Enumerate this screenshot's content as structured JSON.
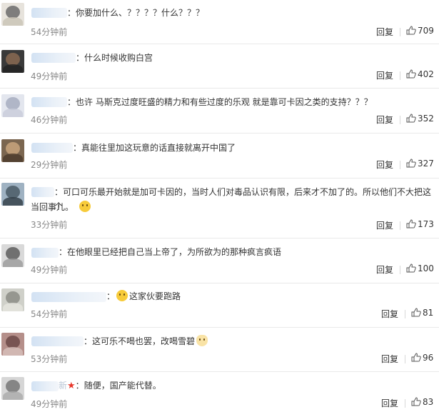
{
  "comments": [
    {
      "text": "你要加什么、？？？？什么？？？",
      "time": "54分钟前",
      "reply": "回复",
      "likes": "709",
      "emoji": ""
    },
    {
      "text": "什么时候收购白宫",
      "time": "49分钟前",
      "reply": "回复",
      "likes": "402",
      "emoji": ""
    },
    {
      "text": "也许 马斯克过度旺盛的精力和有些过度的乐观 就是靠可卡因之类的支持？？？",
      "time": "46分钟前",
      "reply": "回复",
      "likes": "352",
      "emoji": ""
    },
    {
      "text": "真能往里加这玩意的话直接就离开中国了",
      "time": "29分钟前",
      "reply": "回复",
      "likes": "327",
      "emoji": ""
    },
    {
      "text": "可口可乐最开始就是加可卡因的，当时人们对毒品认识有限，后来才不加了的。所以他们不大把这个",
      "text2": "当回事儿。",
      "time": "33分钟前",
      "reply": "回复",
      "likes": "173",
      "emoji": "thinking-emoji"
    },
    {
      "text": "在他眼里已经把自己当上帝了，为所欲为的那种疯言疯语",
      "time": "49分钟前",
      "reply": "回复",
      "likes": "100",
      "emoji": ""
    },
    {
      "text": "这家伙要跑路",
      "time": "54分钟前",
      "reply": "回复",
      "likes": "81",
      "emoji": "laughing-emoji"
    },
    {
      "text": "这可乐不喝也罢，改喝雪碧",
      "time": "53分钟前",
      "reply": "回复",
      "likes": "96",
      "emoji": "cat-emoji"
    },
    {
      "text": "随便，国产能代替。",
      "time": "49分钟前",
      "reply": "回复",
      "likes": "83",
      "emoji": "",
      "name_suffix": "新",
      "star": "★"
    }
  ],
  "colors": {
    "text": "#333333",
    "time": "#888888",
    "divider": "#e9e9e9",
    "star": "#e8362a"
  },
  "icons": {
    "like": "thumbs-up-icon"
  }
}
